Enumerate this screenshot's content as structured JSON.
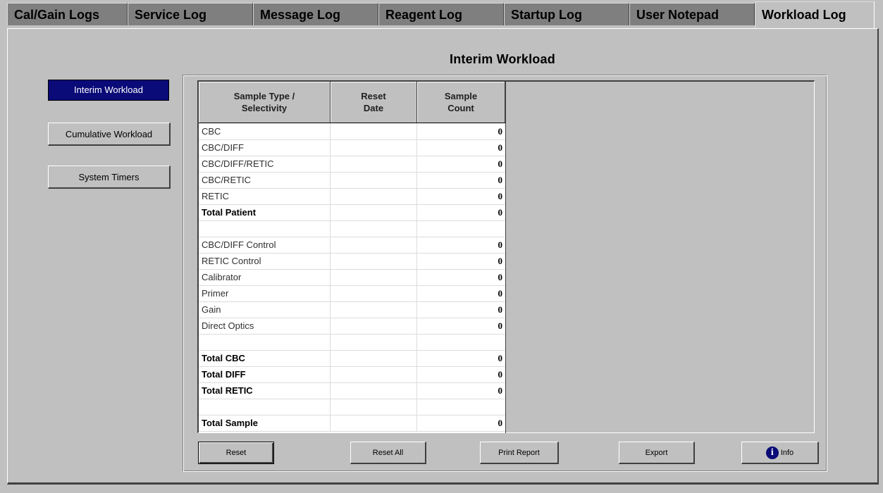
{
  "tabs": [
    {
      "label": "Cal/Gain Logs"
    },
    {
      "label": "Service Log"
    },
    {
      "label": "Message Log"
    },
    {
      "label": "Reagent Log"
    },
    {
      "label": "Startup Log"
    },
    {
      "label": "User Notepad"
    },
    {
      "label": "Workload Log",
      "active": true
    }
  ],
  "page_title": "Interim Workload",
  "nav": {
    "interim": "Interim Workload",
    "cumulative": "Cumulative Workload",
    "timers": "System Timers",
    "selected": "Interim Workload"
  },
  "table": {
    "headers": [
      "Sample Type /\nSelectivity",
      "Reset\nDate",
      "Sample\nCount"
    ],
    "rows": [
      {
        "label": "CBC",
        "date": "",
        "count": "0",
        "bold": false
      },
      {
        "label": "CBC/DIFF",
        "date": "",
        "count": "0",
        "bold": false
      },
      {
        "label": "CBC/DIFF/RETIC",
        "date": "",
        "count": "0",
        "bold": false
      },
      {
        "label": "CBC/RETIC",
        "date": "",
        "count": "0",
        "bold": false
      },
      {
        "label": "RETIC",
        "date": "",
        "count": "0",
        "bold": false
      },
      {
        "label": "Total Patient",
        "date": "",
        "count": "0",
        "bold": true
      },
      {
        "label": "",
        "date": "",
        "count": "",
        "bold": false
      },
      {
        "label": "CBC/DIFF Control",
        "date": "",
        "count": "0",
        "bold": false
      },
      {
        "label": "RETIC Control",
        "date": "",
        "count": "0",
        "bold": false
      },
      {
        "label": "Calibrator",
        "date": "",
        "count": "0",
        "bold": false
      },
      {
        "label": "Primer",
        "date": "",
        "count": "0",
        "bold": false
      },
      {
        "label": "Gain",
        "date": "",
        "count": "0",
        "bold": false
      },
      {
        "label": "Direct Optics",
        "date": "",
        "count": "0",
        "bold": false
      },
      {
        "label": "",
        "date": "",
        "count": "",
        "bold": false
      },
      {
        "label": "Total CBC",
        "date": "",
        "count": "0",
        "bold": true
      },
      {
        "label": "Total DIFF",
        "date": "",
        "count": "0",
        "bold": true
      },
      {
        "label": "Total RETIC",
        "date": "",
        "count": "0",
        "bold": true
      },
      {
        "label": "",
        "date": "",
        "count": "",
        "bold": false
      },
      {
        "label": "Total Sample",
        "date": "",
        "count": "0",
        "bold": true
      }
    ]
  },
  "buttons": {
    "reset": "Reset",
    "reset_all": "Reset All",
    "print_report": "Print Report",
    "export": "Export",
    "info": "Info"
  },
  "colors": {
    "face": "#c0c0c0",
    "selected": "#0a0a78",
    "inactive_tab": "#7f7f7f"
  },
  "icons": {
    "info": "info-icon"
  }
}
